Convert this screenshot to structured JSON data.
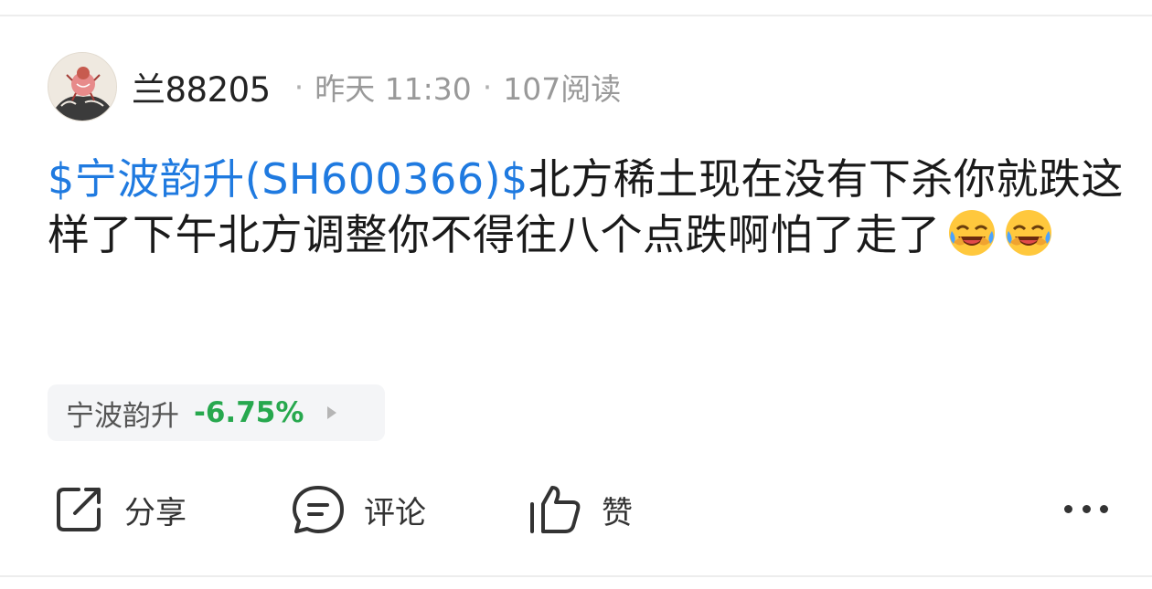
{
  "post": {
    "author": "兰88205",
    "time": "昨天 11:30",
    "reads": "107阅读",
    "stock_tag": "$宁波韵升(SH600366)$",
    "body": "北方稀土现在没有下杀你就跌这样了下午北方调整你不得往八个点跌啊怕了走了"
  },
  "stock_chip": {
    "name": "宁波韵升",
    "change": "-6.75%"
  },
  "actions": {
    "share": "分享",
    "comment": "评论",
    "like": "赞"
  },
  "colors": {
    "link": "#1f7ae0",
    "down": "#27a84e",
    "meta": "#999999"
  },
  "icons": [
    "avatar-image",
    "laughing-crying-emoji",
    "share-icon",
    "comment-icon",
    "thumbs-up-icon",
    "more-icon",
    "chevron-right-icon"
  ]
}
